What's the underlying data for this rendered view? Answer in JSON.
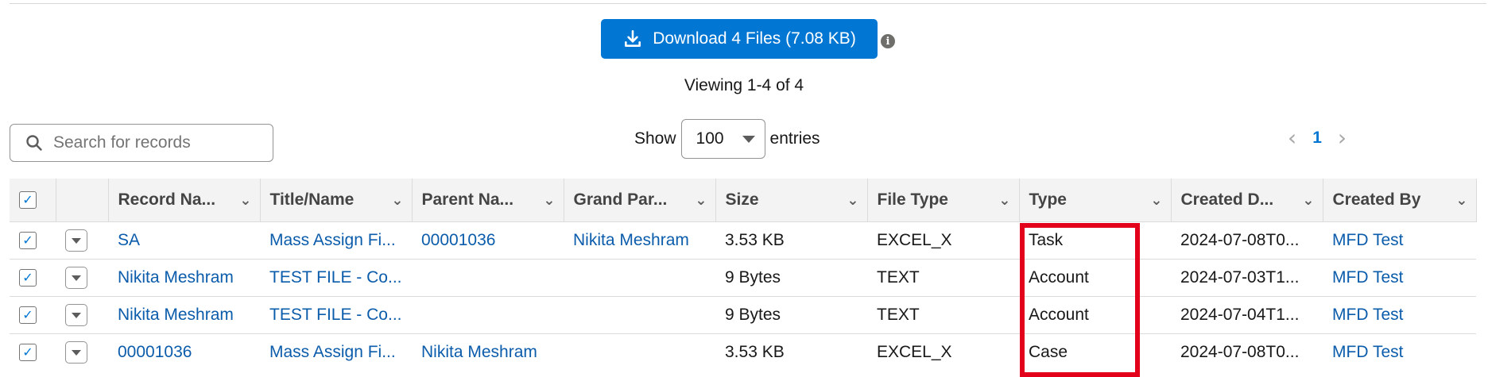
{
  "download": {
    "label": "Download 4 Files (7.08 KB)"
  },
  "viewing_text": "Viewing 1-4 of 4",
  "search": {
    "placeholder": "Search for records"
  },
  "show": {
    "prefix": "Show",
    "value": "100",
    "suffix": "entries"
  },
  "pager": {
    "prev": "‹",
    "page": "1",
    "next": "›"
  },
  "table": {
    "columns": [
      "Record Na...",
      "Title/Name",
      "Parent Na...",
      "Grand Par...",
      "Size",
      "File Type",
      "Type",
      "Created D...",
      "Created By"
    ],
    "rows": [
      [
        "SA",
        "Mass Assign Fi...",
        "00001036",
        "Nikita Meshram",
        "3.53 KB",
        "EXCEL_X",
        "Task",
        "2024-07-08T0...",
        "MFD Test"
      ],
      [
        "Nikita Meshram",
        "TEST FILE - Co...",
        "",
        "",
        "9 Bytes",
        "TEXT",
        "Account",
        "2024-07-03T1...",
        "MFD Test"
      ],
      [
        "Nikita Meshram",
        "TEST FILE - Co...",
        "",
        "",
        "9 Bytes",
        "TEXT",
        "Account",
        "2024-07-04T1...",
        "MFD Test"
      ],
      [
        "00001036",
        "Mass Assign Fi...",
        "Nikita Meshram",
        "",
        "3.53 KB",
        "EXCEL_X",
        "Case",
        "2024-07-08T0...",
        "MFD Test"
      ]
    ],
    "link_columns": [
      0,
      1,
      2,
      3,
      8
    ]
  },
  "colors": {
    "brand": "#0176d3",
    "link": "#0b5cab",
    "highlight": "#e3001b"
  },
  "icons": {
    "download": "download-icon",
    "info": "info-icon",
    "search": "search-icon",
    "checkbox": "checkbox-icon"
  }
}
